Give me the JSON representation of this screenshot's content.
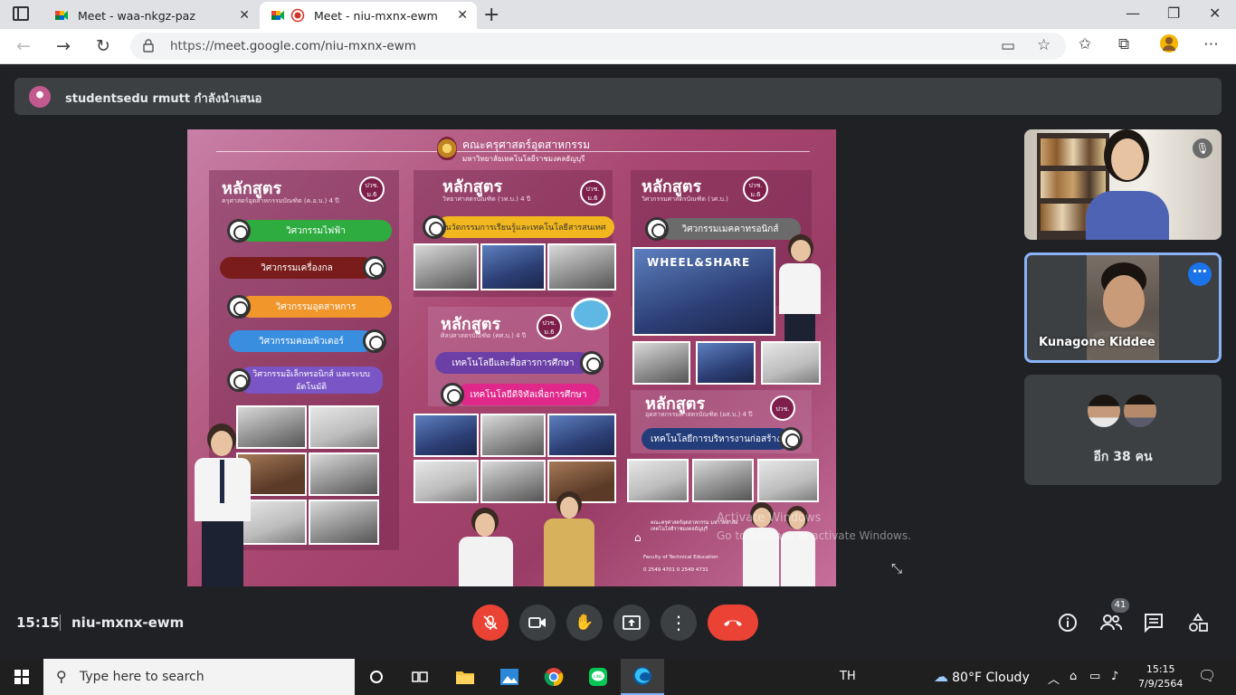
{
  "browser": {
    "tabs": [
      {
        "title": "Meet - waa-nkgz-paz",
        "active": false
      },
      {
        "title": "Meet - niu-mxnx-ewm",
        "active": true
      }
    ],
    "url_prefix": "https://",
    "url_main": "meet.google.com/niu-mxnx-ewm",
    "controls": {
      "minimize": "—",
      "maximize": "❐",
      "close": "✕"
    }
  },
  "meet": {
    "presenting_text": "studentsedu rmutt กำลังนำเสนอ",
    "slide": {
      "header_line1": "คณะครุศาสตร์อุตสาหกรรม",
      "header_line2": "มหาวิทยาลัยเทคโนโลยีราชมงคลธัญบุรี",
      "col1": {
        "heading": "หลักสูตร",
        "sub": "ครุศาสตร์อุตสาหกรรมบัณฑิต (ค.อ.บ.) 4 ปี",
        "badge": "ปวช. ม.6",
        "pills": [
          "วิศวกรรมไฟฟ้า",
          "วิศวกรรมเครื่องกล",
          "วิศวกรรมอุตสาหการ",
          "วิศวกรรมคอมพิวเตอร์",
          "วิศวกรรมอิเล็กทรอนิกส์ และระบบอัตโนมัติ"
        ]
      },
      "col2a": {
        "heading": "หลักสูตร",
        "sub": "วิทยาศาสตรบัณฑิต (วท.บ.) 4 ปี",
        "badge": "ปวช. ม.6",
        "pills": [
          "นวัตกรรมการเรียนรู้และเทคโนโลยีสารสนเทศ"
        ]
      },
      "col2b": {
        "heading": "หลักสูตร",
        "sub": "ศิลปศาสตรบัณฑิต (ศศ.บ.) 4 ปี",
        "badge": "ปวช. ม.6",
        "pills": [
          "เทคโนโลยีและสื่อสารการศึกษา",
          "เทคโนโลยีดิจิทัลเพื่อการศึกษา"
        ]
      },
      "col3a": {
        "heading": "หลักสูตร",
        "sub": "วิศวกรรมศาสตรบัณฑิต (วศ.บ.)",
        "badge": "ปวช. ม.6",
        "pills": [
          "วิศวกรรมเมคคาทรอนิกส์"
        ],
        "banner": "WHEEL&SHARE"
      },
      "col3b": {
        "heading": "หลักสูตร",
        "sub": "อุตสาหกรรมศาสตรบัณฑิต (อส.บ.) 4 ปี",
        "badge": "ปวช.",
        "pills": [
          "เทคโนโลยีการบริหารงานก่อสร้าง"
        ]
      },
      "footer": {
        "addr": "คณะครุศาสตร์อุตสาหกรรม มหาวิทยาลัยเทคโนโลยีราชมงคลธัญบุรี",
        "en": "Faculty of Technical Education",
        "phone": "0 2549 4701 0 2549 4731"
      }
    },
    "watermark1": "Activate Windows",
    "watermark2": "Go to Settings to activate Windows.",
    "participants": [
      {
        "name": "",
        "muted": true
      },
      {
        "name": "Kunagone Kiddee",
        "selected": true
      },
      {
        "others_label": "อีก 38 คน"
      }
    ],
    "controls": {
      "time": "15:15",
      "meeting_code": "niu-mxnx-ewm",
      "people_count": "41"
    }
  },
  "taskbar": {
    "search_placeholder": "Type here to search",
    "lang": "TH",
    "weather": "80°F  Cloudy",
    "time": "15:15",
    "date": "7/9/2564"
  },
  "colors": {
    "accent": "#1a73e8",
    "danger": "#ea4335",
    "meet_bg": "#202124"
  }
}
